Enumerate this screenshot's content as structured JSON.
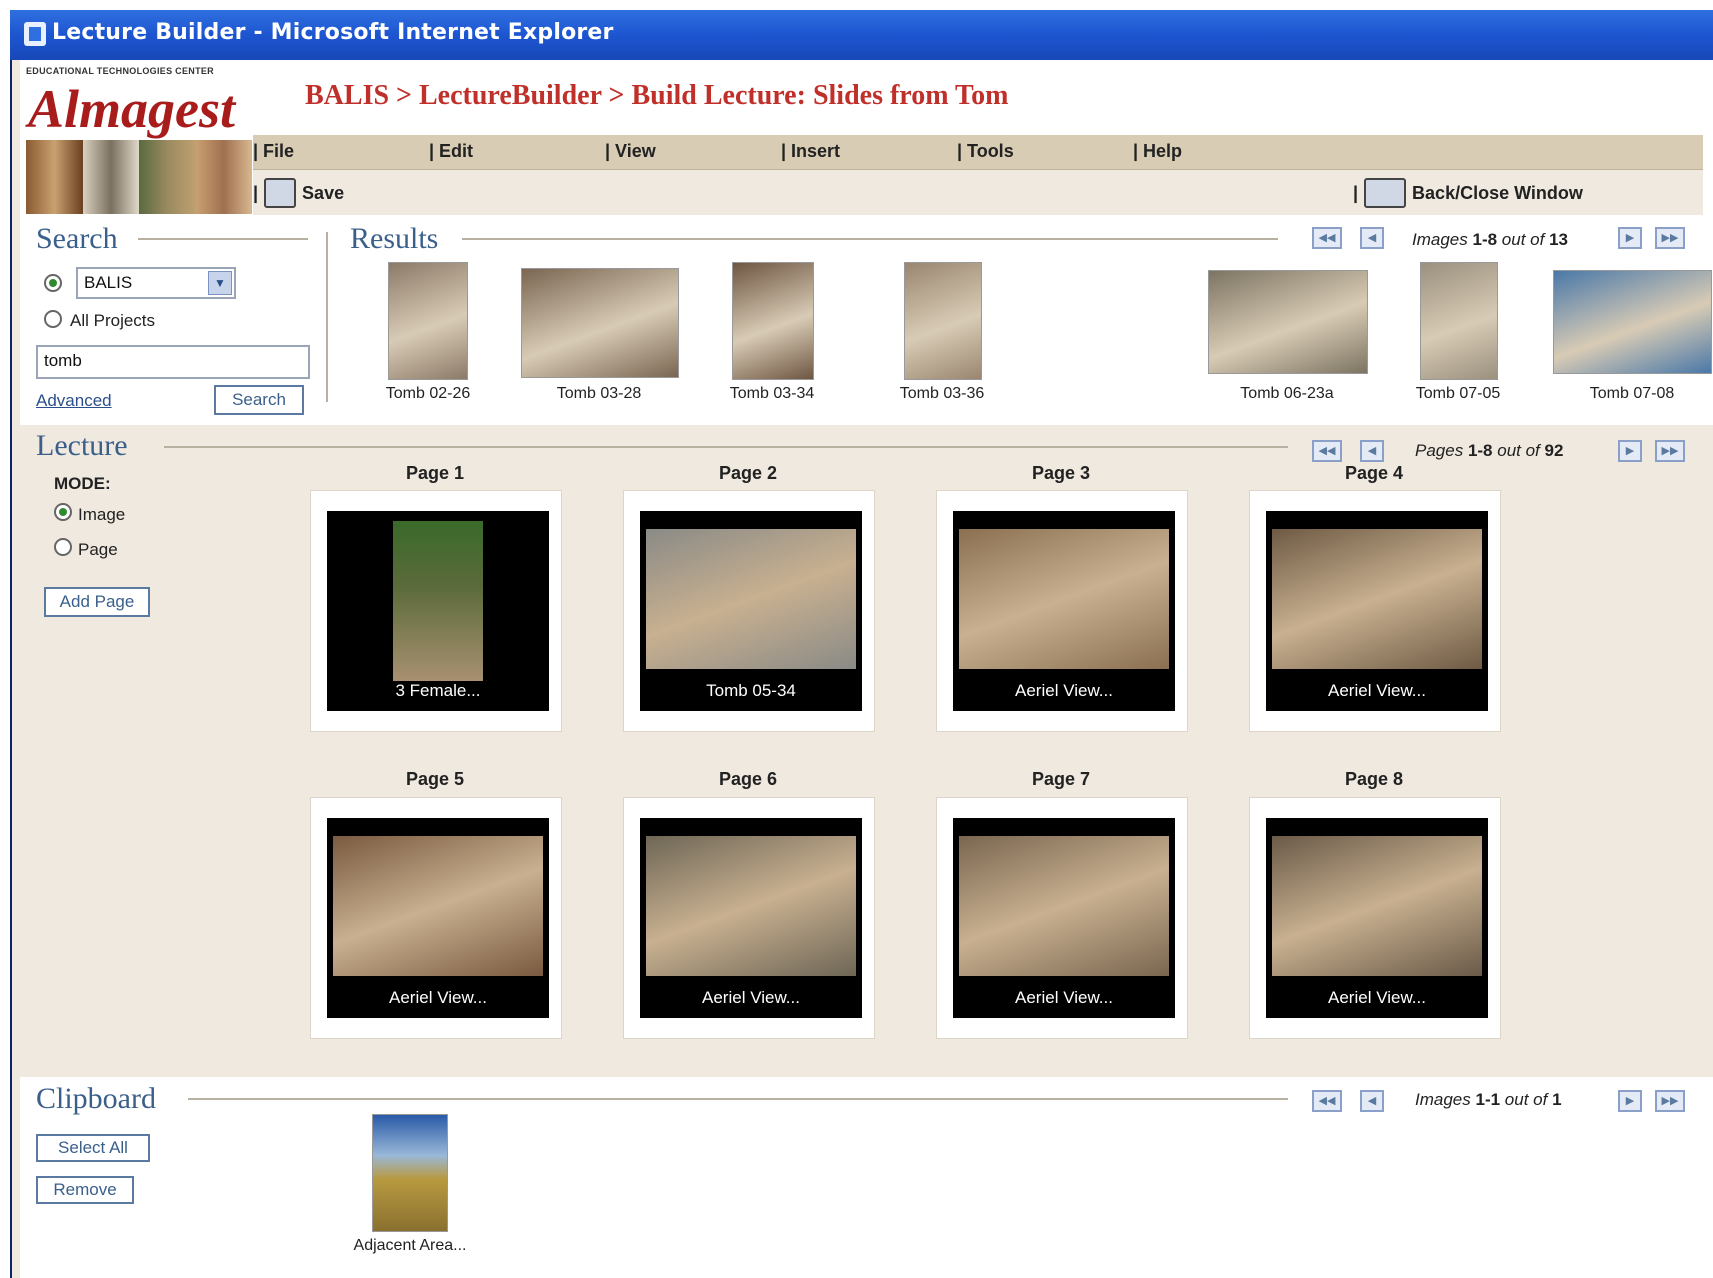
{
  "window": {
    "title": "Lecture Builder - Microsoft Internet Explorer"
  },
  "header": {
    "logo_small": "EDUCATIONAL TECHNOLOGIES CENTER",
    "logo": "Almagest",
    "breadcrumb": "BALIS > LectureBuilder > Build Lecture: Slides from Tom"
  },
  "menu": {
    "file": "| File",
    "edit": "| Edit",
    "view": "| View",
    "insert": "| Insert",
    "tools": "| Tools",
    "help": "| Help"
  },
  "toolbar": {
    "save": "Save",
    "back_close": "Back/Close Window",
    "sep": "|"
  },
  "search": {
    "title": "Search",
    "project_selected": "BALIS",
    "all_projects": "All Projects",
    "query": "tomb",
    "advanced": "Advanced",
    "button": "Search"
  },
  "results": {
    "title": "Results",
    "pager": {
      "label": "Images",
      "range": "1-8",
      "out_of": "out of",
      "total": "13"
    },
    "items": [
      {
        "caption": "Tomb 02-26",
        "color": "#8c7a68"
      },
      {
        "caption": "Tomb 03-28",
        "color": "#7a6652"
      },
      {
        "caption": "Tomb 03-34",
        "color": "#6e5642"
      },
      {
        "caption": "Tomb 03-36",
        "color": "#9a8670"
      },
      {
        "caption": "Tomb 06-23a",
        "color": "#7c7462"
      },
      {
        "caption": "Tomb 07-05",
        "color": "#9a907e"
      },
      {
        "caption": "Tomb 07-08",
        "color": "#4a78a8"
      }
    ]
  },
  "lecture": {
    "title": "Lecture",
    "mode_label": "MODE:",
    "mode_image": "Image",
    "mode_page": "Page",
    "add_page": "Add Page",
    "pager": {
      "label": "Pages",
      "range": "1-8",
      "out_of": "out of",
      "total": "92"
    },
    "pages": [
      {
        "label": "Page 1",
        "caption": "3 Female...",
        "color": "#5a6a3a"
      },
      {
        "label": "Page 2",
        "caption": "Tomb 05-34",
        "color": "#8a8a86"
      },
      {
        "label": "Page 3",
        "caption": "Aeriel View...",
        "color": "#8a7050"
      },
      {
        "label": "Page 4",
        "caption": "Aeriel View...",
        "color": "#6e5a44"
      },
      {
        "label": "Page 5",
        "caption": "Aeriel View...",
        "color": "#7a5a40"
      },
      {
        "label": "Page 6",
        "caption": "Aeriel View...",
        "color": "#6e6656"
      },
      {
        "label": "Page 7",
        "caption": "Aeriel View...",
        "color": "#7a6650"
      },
      {
        "label": "Page 8",
        "caption": "Aeriel View...",
        "color": "#6a5a48"
      }
    ]
  },
  "clipboard": {
    "title": "Clipboard",
    "select_all": "Select All",
    "remove": "Remove",
    "pager": {
      "label": "Images",
      "range": "1-1",
      "out_of": "out of",
      "total": "1"
    },
    "items": [
      {
        "caption": "Adjacent Area...",
        "color": "#b89a40"
      }
    ]
  },
  "icons": {
    "first": "first-page-icon",
    "prev": "prev-page-icon",
    "next": "next-page-icon",
    "last": "last-page-icon",
    "dropdown": "chevron-down-icon",
    "save": "save-icon",
    "back": "back-arrow-icon"
  }
}
